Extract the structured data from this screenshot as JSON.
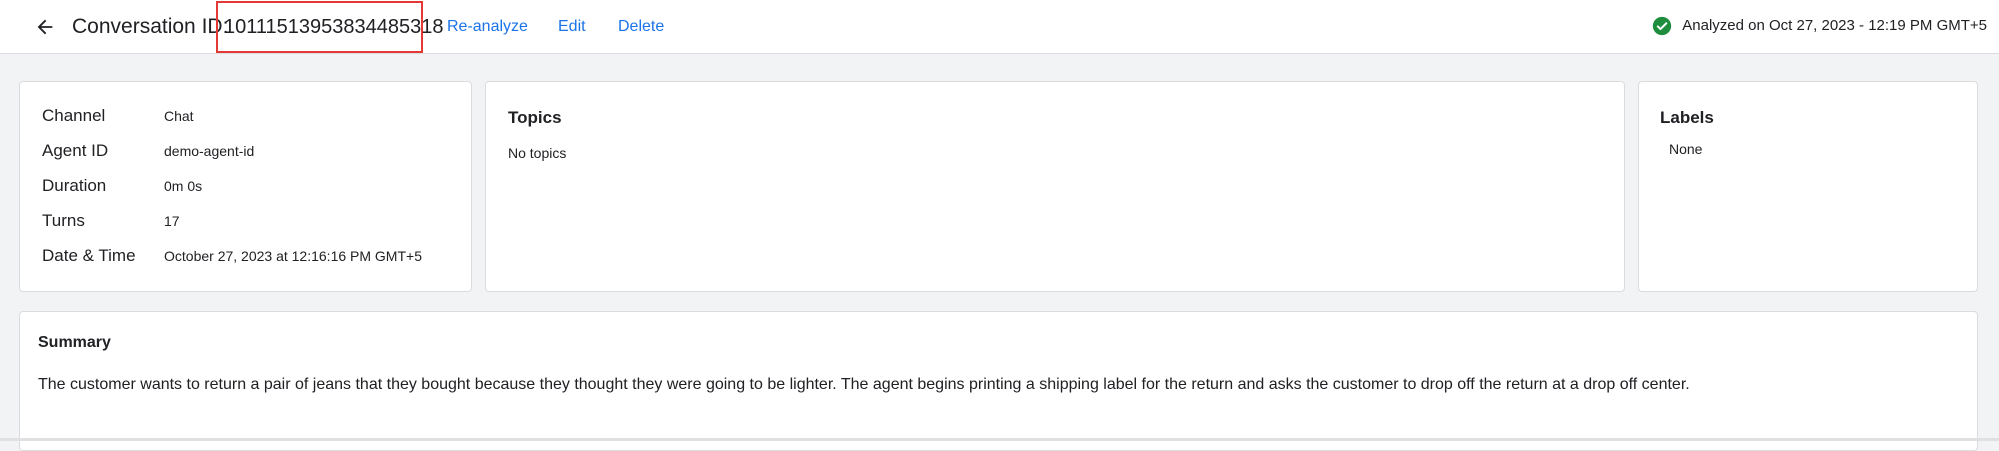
{
  "header": {
    "title_prefix": "Conversation ID:",
    "conversation_id": "10111513953834485318",
    "actions": {
      "reanalyze": "Re-analyze",
      "edit": "Edit",
      "delete": "Delete"
    },
    "status_text": "Analyzed on Oct 27, 2023 - 12:19 PM GMT+5",
    "status_color": "#1e8e3e",
    "accent_color": "#1a73e8",
    "highlight_color": "#e53935"
  },
  "info": {
    "rows": [
      {
        "label": "Channel",
        "value": "Chat"
      },
      {
        "label": "Agent ID",
        "value": "demo-agent-id"
      },
      {
        "label": "Duration",
        "value": "0m 0s"
      },
      {
        "label": "Turns",
        "value": "17"
      },
      {
        "label": "Date & Time",
        "value": "October 27, 2023 at 12:16:16 PM GMT+5"
      }
    ]
  },
  "topics": {
    "title": "Topics",
    "empty_text": "No topics"
  },
  "labels": {
    "title": "Labels",
    "empty_text": "None"
  },
  "summary": {
    "title": "Summary",
    "text": "The customer wants to return a pair of jeans that they bought because they thought they were going to be lighter. The agent begins printing a shipping label for the return and asks the customer to drop off the return at a drop off center."
  },
  "icons": {
    "back": "arrow-back-icon",
    "status": "check-circle-icon"
  }
}
